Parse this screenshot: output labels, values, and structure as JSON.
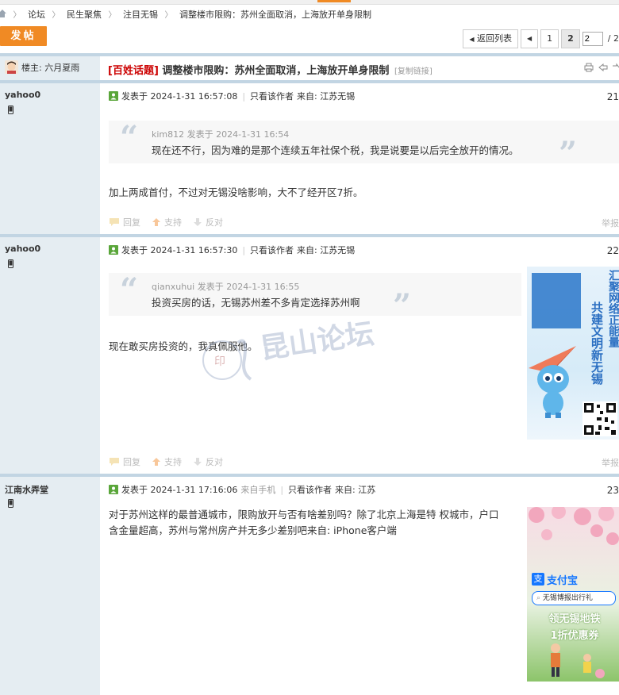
{
  "breadcrumb": {
    "items": [
      "论坛",
      "民生聚焦",
      "注目无锡",
      "调整楼市限购：苏州全面取消，上海放开单身限制"
    ]
  },
  "post_button": "发帖",
  "pager": {
    "back": "返回列表",
    "pages": [
      "1",
      "2"
    ],
    "current_page": "2",
    "input_value": "2",
    "total": "/ 2"
  },
  "thread": {
    "owner_label": "楼主: 六月夏雨",
    "tag": "[百姓话题]",
    "title": "调整楼市限购：苏州全面取消，上海放开单身限制",
    "copy_link": "[复制链接]"
  },
  "posts": [
    {
      "author": "yahoo0",
      "posted": "发表于 2024-1-31 16:57:08",
      "only_author": "只看该作者",
      "from": "来自: 江苏无锡",
      "floor": "21",
      "quote_author": "kim812 发表于 2024-1-31 16:54",
      "quote_text": "现在还不行，因为难的是那个连续五年社保个税，我是说要是以后完全放开的情况。",
      "body": "加上两成首付，不过对无锡没啥影响，大不了经开区7折。",
      "actions": [
        "回复",
        "支持",
        "反对"
      ],
      "report": "举报"
    },
    {
      "author": "yahoo0",
      "posted": "发表于 2024-1-31 16:57:30",
      "only_author": "只看该作者",
      "from": "来自: 江苏无锡",
      "floor": "22",
      "quote_author": "qianxuhui 发表于 2024-1-31 16:55",
      "quote_text": "投资买房的话，无锡苏州差不多肯定选择苏州啊",
      "body": "现在敢买房投资的，我真佩服他。",
      "actions": [
        "回复",
        "支持",
        "反对"
      ],
      "report": "举报",
      "ad": {
        "line1": "汇聚网络正能量",
        "line2": "共建文明新无锡"
      }
    },
    {
      "author": "江南水弄堂",
      "posted": "发表于 2024-1-31 17:16:06",
      "device": "来自手机",
      "only_author": "只看该作者",
      "from": "来自: 江苏",
      "floor": "23",
      "body_line1": "对于苏州这样的最普通城市，限购放开与否有啥差别吗？除了北京上海是特 权城市，户口",
      "body_line2": "含金量超高，苏州与常州房产并无多少差别吧来自: iPhone客户端",
      "ad": {
        "brand": "支付宝",
        "search": "无锡博报出行礼",
        "line1": "领无锡地铁",
        "line2": "1折优惠券"
      }
    }
  ],
  "watermark": "昆山论坛",
  "colors": {
    "accent": "#f08a24",
    "sidebar": "#e5edf2",
    "divider": "#c2d5e3",
    "tag": "#cc0000"
  }
}
